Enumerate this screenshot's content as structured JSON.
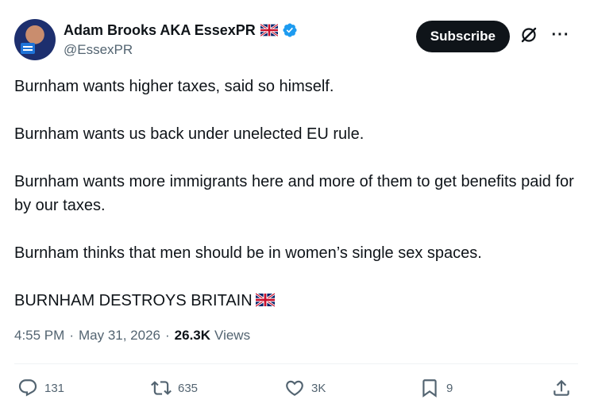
{
  "author": {
    "display_name": "Adam Brooks AKA EssexPR",
    "handle": "@EssexPR",
    "name_emoji": "uk-flag-icon",
    "verified": true,
    "verified_color": "#1d9bf0"
  },
  "header": {
    "subscribe_label": "Subscribe",
    "more_label": "···"
  },
  "tweet": {
    "paragraphs": [
      "Burnham wants higher taxes, said so himself.",
      "Burnham wants us back under unelected EU rule.",
      "Burnham wants more immigrants here and more of them to get benefits paid for by our taxes.",
      "Burnham thinks that men should be in women’s single sex spaces.",
      "BURNHAM DESTROYS BRITAIN"
    ]
  },
  "meta": {
    "time": "4:55 PM",
    "separator": "·",
    "date": "May 31, 2026",
    "views_count": "26.3K",
    "views_label": "Views"
  },
  "actions": {
    "replies": "131",
    "reposts": "635",
    "likes": "3K",
    "bookmarks": "9"
  },
  "colors": {
    "text": "#0f1419",
    "secondary": "#536471",
    "button_bg": "#0f1419",
    "divider": "#eff3f4"
  }
}
